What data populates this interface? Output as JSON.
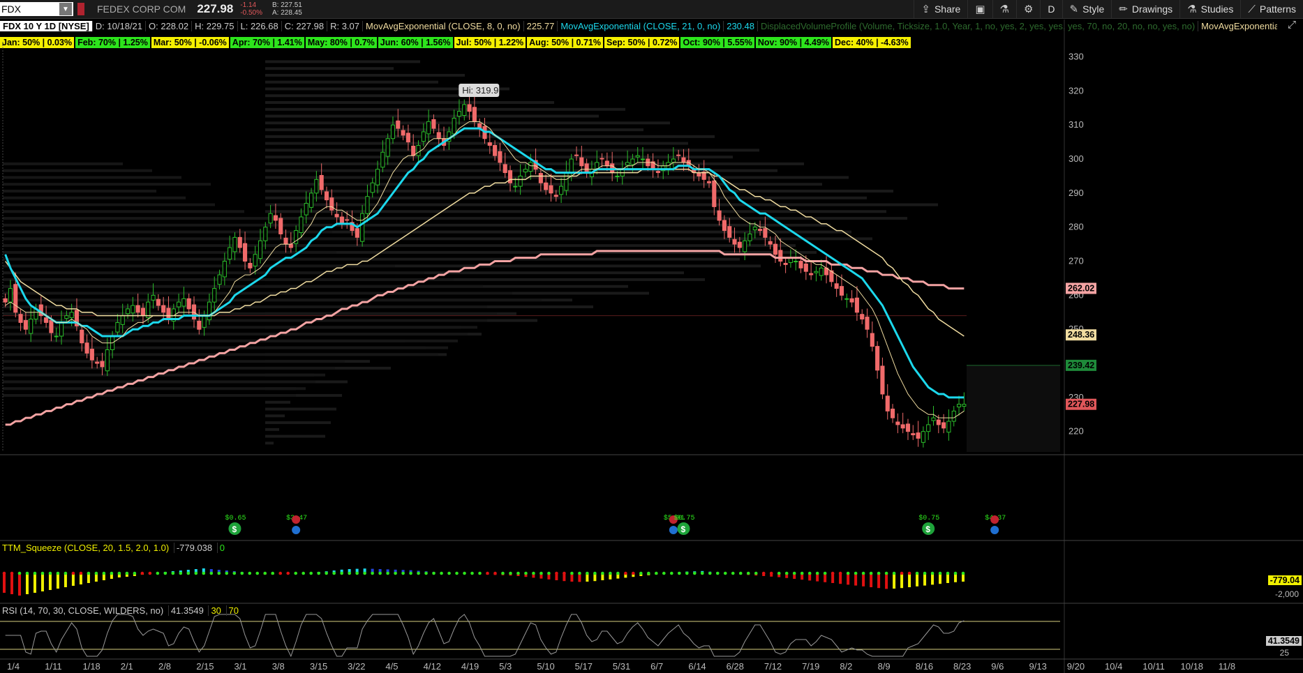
{
  "topbar": {
    "symbol": "FDX",
    "company": "FEDEX CORP COM",
    "last": "227.98",
    "change": "-1.14",
    "change_pct": "-0.50%",
    "bid": "B: 227.51",
    "ask": "A: 228.45",
    "buttons": [
      {
        "label": "Share",
        "icon": "share-icon"
      },
      {
        "label": "",
        "icon": "monitor-icon"
      },
      {
        "label": "",
        "icon": "flask-icon"
      },
      {
        "label": "",
        "icon": "gear-icon"
      },
      {
        "label": "D",
        "icon": ""
      },
      {
        "label": "Style",
        "icon": "style-icon"
      },
      {
        "label": "Drawings",
        "icon": "pencil-icon"
      },
      {
        "label": "Studies",
        "icon": "flask-icon"
      },
      {
        "label": "Patterns",
        "icon": "pattern-icon"
      }
    ]
  },
  "studybar": {
    "title": "FDX 10 Y 1D [NYSE]",
    "date": "D: 10/18/21",
    "open": "O: 228.02",
    "high": "H: 229.75",
    "low": "L: 226.68",
    "close": "C: 227.98",
    "range": "R: 3.07",
    "ema8": "MovAvgExponential (CLOSE, 8, 0, no)",
    "ema8_val": "225.77",
    "ema21": "MovAvgExponential (CLOSE, 21, 0, no)",
    "ema21_val": "230.48",
    "dvp": "DisplacedVolumeProfile (Volume, Ticksize, 1.0, Year, 1, no, yes, 2, yes, yes, yes, 70, no, 20, no, no, yes, no)",
    "ema200": "MovAvgExponential ..."
  },
  "seasonality": [
    {
      "text": "Jan: 50% | 0.03%",
      "color": "#f5f000"
    },
    {
      "text": "Feb: 70% | 1.25%",
      "color": "#2de51c"
    },
    {
      "text": "Mar: 50% | -0.06%",
      "color": "#f5f000"
    },
    {
      "text": "Apr: 70% | 1.41%",
      "color": "#2de51c"
    },
    {
      "text": "May: 80% | 0.7%",
      "color": "#2de51c"
    },
    {
      "text": "Jun: 60% | 1.56%",
      "color": "#2de51c"
    },
    {
      "text": "Jul: 50% | 1.22%",
      "color": "#f5f000"
    },
    {
      "text": "Aug: 50% | 0.71%",
      "color": "#f5f000"
    },
    {
      "text": "Sep: 50% | 0.72%",
      "color": "#f5f000"
    },
    {
      "text": "Oct: 90% | 5.55%",
      "color": "#2de51c"
    },
    {
      "text": "Nov: 90% | 4.49%",
      "color": "#2de51c"
    },
    {
      "text": "Dec: 40% | -4.63%",
      "color": "#f5f000"
    }
  ],
  "chart_data": {
    "type": "candlestick",
    "symbol": "FDX",
    "hi_label": "Hi: 319.9",
    "y_ticks": [
      "330",
      "320",
      "310",
      "300",
      "290",
      "280",
      "270",
      "260",
      "250",
      "240",
      "230",
      "220"
    ],
    "ylim": [
      214,
      334
    ],
    "x_ticks": [
      "1/4",
      "1/11",
      "1/18",
      "2/1",
      "2/8",
      "2/15",
      "3/1",
      "3/8",
      "3/15",
      "3/22",
      "4/5",
      "4/12",
      "4/19",
      "5/3",
      "5/10",
      "5/17",
      "5/31",
      "6/7",
      "6/14",
      "6/28",
      "7/12",
      "7/19",
      "8/2",
      "8/9",
      "8/16",
      "8/23",
      "9/6",
      "9/13",
      "9/20",
      "10/4",
      "10/11",
      "10/18",
      "11/8"
    ],
    "price_tags": [
      {
        "value": "262.02",
        "color": "#f4a3a3"
      },
      {
        "value": "248.36",
        "color": "#f0dca0"
      },
      {
        "value": "239.42",
        "color": "#1e8a3a"
      },
      {
        "value": "227.98",
        "color": "#e0575a"
      }
    ],
    "closes": [
      258,
      262,
      255,
      252,
      250,
      253,
      256,
      254,
      252,
      249,
      248,
      252,
      254,
      255,
      251,
      246,
      243,
      241,
      240,
      239,
      244,
      248,
      252,
      254,
      256,
      257,
      255,
      254,
      258,
      260,
      257,
      255,
      253,
      256,
      258,
      259,
      256,
      253,
      250,
      254,
      258,
      262,
      266,
      270,
      274,
      277,
      274,
      270,
      268,
      272,
      276,
      280,
      284,
      282,
      278,
      275,
      274,
      279,
      283,
      287,
      290,
      294,
      291,
      288,
      285,
      283,
      281,
      282,
      279,
      277,
      284,
      289,
      293,
      297,
      302,
      306,
      310,
      309,
      307,
      305,
      301,
      304,
      308,
      311,
      309,
      306,
      304,
      308,
      312,
      314,
      316,
      314,
      311,
      309,
      306,
      304,
      301,
      299,
      296,
      293,
      292,
      295,
      297,
      299,
      297,
      293,
      291,
      290,
      289,
      292,
      296,
      300,
      301,
      298,
      296,
      297,
      299,
      300,
      298,
      296,
      295,
      297,
      299,
      300,
      301,
      300,
      298,
      297,
      296,
      298,
      299,
      300,
      301,
      299,
      298,
      296,
      295,
      294,
      293,
      286,
      282,
      279,
      277,
      275,
      274,
      276,
      278,
      280,
      279,
      277,
      275,
      272,
      270,
      269,
      271,
      270,
      268,
      267,
      266,
      267,
      268,
      266,
      264,
      262,
      260,
      259,
      258,
      255,
      253,
      250,
      245,
      238,
      231,
      226,
      224,
      222,
      221,
      220,
      219,
      218,
      220,
      222,
      224,
      222,
      221,
      223,
      226,
      228,
      228
    ],
    "ema8": [
      257,
      258,
      257,
      256,
      255,
      255,
      255,
      255,
      254,
      253,
      252,
      252,
      252,
      253,
      252,
      251,
      250,
      248,
      247,
      246,
      246,
      246,
      247,
      248,
      250,
      251,
      252,
      252,
      253,
      254,
      254,
      254,
      254,
      254,
      255,
      255,
      255,
      255,
      254,
      254,
      254,
      255,
      257,
      259,
      261,
      264,
      265,
      266,
      266,
      267,
      268,
      270,
      272,
      274,
      275,
      275,
      275,
      276,
      277,
      279,
      281,
      284,
      285,
      286,
      286,
      285,
      285,
      284,
      283,
      282,
      282,
      283,
      285,
      287,
      290,
      293,
      296,
      298,
      300,
      301,
      301,
      302,
      303,
      305,
      306,
      306,
      306,
      306,
      307,
      309,
      310,
      311,
      311,
      311,
      310,
      309,
      307,
      306,
      304,
      302,
      300,
      299,
      299,
      298,
      298,
      297,
      296,
      295,
      294,
      294,
      294,
      295,
      296,
      297,
      297,
      297,
      297,
      298,
      298,
      298,
      297,
      297,
      298,
      298,
      299,
      299,
      299,
      299,
      298,
      298,
      298,
      299,
      299,
      299,
      299,
      298,
      297,
      297,
      296,
      294,
      292,
      289,
      287,
      285,
      283,
      282,
      281,
      281,
      280,
      280,
      279,
      278,
      276,
      275,
      274,
      273,
      272,
      271,
      270,
      269,
      269,
      268,
      267,
      266,
      265,
      264,
      263,
      262,
      260,
      258,
      256,
      253,
      249,
      245,
      241,
      237,
      234,
      231,
      229,
      227,
      226,
      225,
      225,
      224,
      224,
      224,
      224,
      225,
      226
    ],
    "ema21": [
      272,
      268,
      265,
      262,
      259,
      257,
      256,
      255,
      254,
      253,
      252,
      252,
      252,
      252,
      252,
      251,
      251,
      250,
      249,
      248,
      248,
      248,
      248,
      248,
      249,
      250,
      250,
      251,
      251,
      252,
      252,
      253,
      253,
      253,
      253,
      254,
      254,
      254,
      254,
      254,
      254,
      255,
      256,
      257,
      258,
      260,
      261,
      262,
      263,
      264,
      265,
      266,
      268,
      269,
      270,
      271,
      271,
      272,
      273,
      274,
      276,
      277,
      279,
      280,
      280,
      281,
      281,
      281,
      281,
      280,
      281,
      282,
      283,
      284,
      286,
      288,
      290,
      292,
      294,
      296,
      297,
      299,
      300,
      302,
      303,
      304,
      305,
      306,
      307,
      308,
      309,
      309,
      309,
      309,
      308,
      308,
      307,
      306,
      305,
      304,
      303,
      302,
      301,
      300,
      299,
      298,
      297,
      297,
      296,
      296,
      296,
      296,
      296,
      296,
      296,
      296,
      297,
      297,
      297,
      297,
      297,
      297,
      297,
      297,
      297,
      297,
      297,
      297,
      297,
      297,
      297,
      297,
      298,
      298,
      298,
      297,
      297,
      297,
      297,
      296,
      295,
      293,
      291,
      290,
      288,
      287,
      286,
      285,
      284,
      284,
      283,
      282,
      281,
      280,
      279,
      278,
      277,
      276,
      275,
      274,
      273,
      272,
      271,
      270,
      269,
      268,
      267,
      266,
      265,
      263,
      261,
      259,
      257,
      254,
      251,
      248,
      245,
      242,
      239,
      237,
      235,
      233,
      232,
      231,
      231,
      230,
      230,
      230,
      230
    ],
    "ema50": [
      270,
      268,
      266,
      264,
      263,
      262,
      261,
      260,
      259,
      258,
      257,
      257,
      256,
      256,
      256,
      255,
      255,
      255,
      254,
      254,
      254,
      254,
      254,
      254,
      254,
      254,
      254,
      254,
      254,
      254,
      254,
      254,
      254,
      254,
      254,
      254,
      254,
      254,
      254,
      254,
      254,
      254,
      255,
      255,
      255,
      256,
      256,
      257,
      257,
      258,
      258,
      259,
      260,
      260,
      261,
      261,
      262,
      262,
      263,
      264,
      264,
      265,
      266,
      267,
      267,
      268,
      268,
      269,
      269,
      269,
      270,
      270,
      271,
      272,
      273,
      274,
      275,
      276,
      277,
      278,
      279,
      280,
      281,
      282,
      283,
      284,
      285,
      286,
      287,
      288,
      289,
      290,
      290,
      291,
      292,
      292,
      293,
      293,
      293,
      294,
      294,
      294,
      294,
      295,
      295,
      295,
      295,
      295,
      295,
      295,
      295,
      295,
      295,
      296,
      296,
      296,
      296,
      296,
      296,
      296,
      296,
      296,
      296,
      296,
      296,
      297,
      297,
      297,
      297,
      297,
      297,
      297,
      297,
      297,
      297,
      296,
      296,
      296,
      296,
      295,
      295,
      294,
      293,
      292,
      291,
      291,
      290,
      289,
      289,
      288,
      288,
      287,
      286,
      286,
      285,
      285,
      284,
      283,
      283,
      282,
      281,
      281,
      280,
      279,
      279,
      278,
      277,
      276,
      275,
      274,
      273,
      272,
      271,
      269,
      268,
      266,
      264,
      263,
      261,
      260,
      258,
      256,
      255,
      253,
      252,
      251,
      250,
      249,
      248
    ],
    "ema200": [
      222,
      222,
      223,
      223,
      224,
      224,
      225,
      225,
      226,
      226,
      227,
      227,
      228,
      228,
      229,
      229,
      230,
      230,
      231,
      231,
      232,
      232,
      233,
      233,
      234,
      234,
      235,
      235,
      236,
      236,
      237,
      237,
      238,
      238,
      239,
      239,
      240,
      240,
      241,
      241,
      242,
      242,
      243,
      243,
      244,
      244,
      245,
      245,
      246,
      246,
      247,
      247,
      248,
      248,
      249,
      249,
      250,
      250,
      251,
      252,
      252,
      253,
      253,
      254,
      254,
      255,
      256,
      256,
      257,
      257,
      258,
      258,
      259,
      260,
      260,
      261,
      261,
      262,
      262,
      263,
      263,
      264,
      264,
      265,
      265,
      266,
      266,
      267,
      267,
      267,
      268,
      268,
      268,
      269,
      269,
      269,
      270,
      270,
      270,
      270,
      271,
      271,
      271,
      271,
      271,
      272,
      272,
      272,
      272,
      272,
      272,
      272,
      272,
      272,
      272,
      272,
      273,
      273,
      273,
      273,
      273,
      273,
      273,
      273,
      273,
      273,
      273,
      273,
      273,
      273,
      273,
      273,
      273,
      273,
      273,
      273,
      273,
      273,
      273,
      273,
      273,
      272,
      272,
      272,
      272,
      272,
      272,
      272,
      272,
      272,
      272,
      271,
      271,
      271,
      271,
      271,
      271,
      270,
      270,
      270,
      270,
      270,
      269,
      269,
      269,
      269,
      268,
      268,
      268,
      267,
      267,
      267,
      266,
      266,
      266,
      265,
      265,
      265,
      264,
      264,
      264,
      263,
      263,
      263,
      263,
      262,
      262,
      262,
      262
    ],
    "events": [
      {
        "type": "dividend",
        "label": "$0.65",
        "idx": 45
      },
      {
        "type": "earnings",
        "label": "$3.47",
        "idx": 57
      },
      {
        "type": "earnings",
        "label": "$5.01",
        "idx": 131
      },
      {
        "type": "dividend",
        "label": "$0.75",
        "idx": 133
      },
      {
        "type": "dividend",
        "label": "$0.75",
        "idx": 181
      },
      {
        "type": "earnings",
        "label": "$4.37",
        "idx": 194
      }
    ]
  },
  "squeeze": {
    "label": "TTM_Squeeze (CLOSE, 20, 1.5, 2.0, 1.0)",
    "value": "-779.038",
    "zero": "0",
    "tag": "-779.04",
    "tick_low": "-2,000",
    "histogram": [
      -1400,
      -1500,
      -1600,
      -1500,
      -1400,
      -1300,
      -1200,
      -1100,
      -1000,
      -900,
      -800,
      -700,
      -600,
      -500,
      -400,
      -300,
      -250,
      -200,
      -100,
      -50,
      50,
      100,
      150,
      200,
      250,
      300,
      350,
      300,
      250,
      200,
      150,
      100,
      50,
      -50,
      -100,
      -80,
      -60,
      -40,
      -20,
      20,
      60,
      100,
      140,
      200,
      260,
      300,
      320,
      340,
      320,
      300,
      280,
      260,
      240,
      220,
      180,
      140,
      100,
      60,
      30,
      -20,
      -40,
      -60,
      -80,
      -100,
      -120,
      -140,
      -160,
      -200,
      -260,
      -320,
      -380,
      -440,
      -500,
      -560,
      -600,
      -620,
      -600,
      -560,
      -500,
      -440,
      -380,
      -320,
      -260,
      -200,
      -140,
      -80,
      -40,
      40,
      80,
      120,
      140,
      160,
      120,
      80,
      40,
      -40,
      -80,
      -120,
      -160,
      -200,
      -240,
      -280,
      -340,
      -400,
      -460,
      -520,
      -580,
      -640,
      -700,
      -760,
      -820,
      -880,
      -940,
      -1000,
      -1060,
      -1120,
      -1100,
      -1060,
      -1000,
      -940,
      -880,
      -820,
      -760,
      -700,
      -640,
      -600
    ]
  },
  "rsi": {
    "label": "RSI (14, 70, 30, CLOSE, WILDERS, no)",
    "value": "41.3549",
    "oversold": "30",
    "overbought": "70",
    "tag": "41.3549",
    "tick_low": "25"
  },
  "colors": {
    "up": "#2bbf2b",
    "down": "#f06a6a",
    "ema8": "#f0dca0",
    "ema21": "#1cd8ec",
    "ema200": "#f4a3a3",
    "background": "#000000"
  }
}
